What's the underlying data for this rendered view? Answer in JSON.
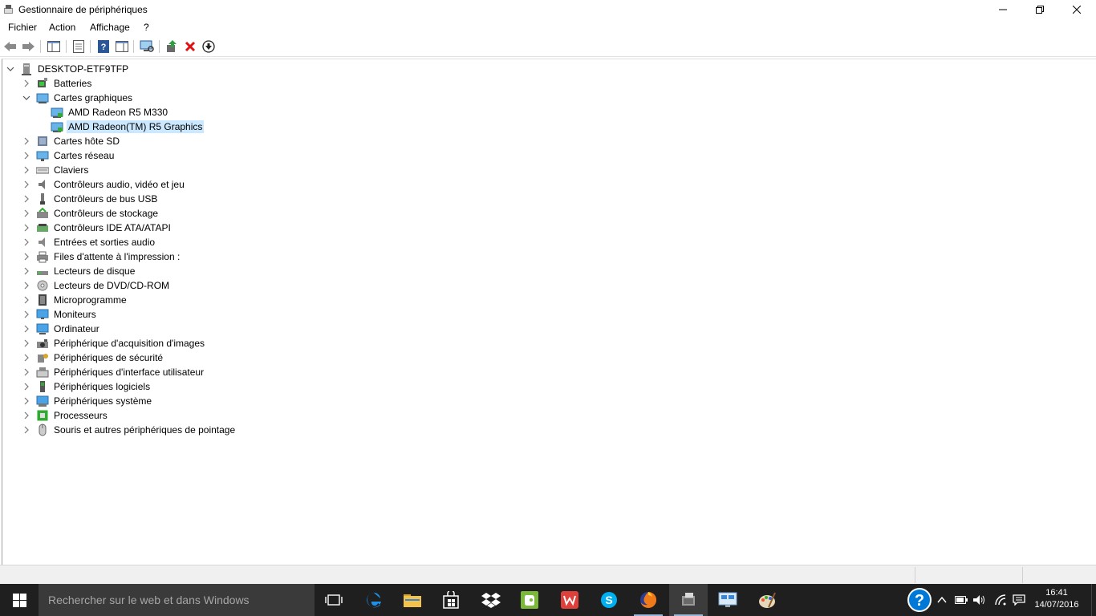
{
  "window": {
    "title": "Gestionnaire de périphériques"
  },
  "menu": [
    "Fichier",
    "Action",
    "Affichage",
    "?"
  ],
  "tree": {
    "root": "DESKTOP-ETF9TFP",
    "categories": [
      {
        "label": "Batteries",
        "icon": "battery-icon",
        "expanded": false
      },
      {
        "label": "Cartes graphiques",
        "icon": "display-adapter-icon",
        "expanded": true,
        "children": [
          "AMD Radeon R5 M330",
          "AMD Radeon(TM) R5 Graphics"
        ]
      },
      {
        "label": "Cartes hôte SD",
        "icon": "sd-host-icon",
        "expanded": false
      },
      {
        "label": "Cartes réseau",
        "icon": "network-adapter-icon",
        "expanded": false
      },
      {
        "label": "Claviers",
        "icon": "keyboard-icon",
        "expanded": false
      },
      {
        "label": "Contrôleurs audio, vidéo et jeu",
        "icon": "audio-icon",
        "expanded": false
      },
      {
        "label": "Contrôleurs de bus USB",
        "icon": "usb-icon",
        "expanded": false
      },
      {
        "label": "Contrôleurs de stockage",
        "icon": "storage-controller-icon",
        "expanded": false
      },
      {
        "label": "Contrôleurs IDE ATA/ATAPI",
        "icon": "ide-icon",
        "expanded": false
      },
      {
        "label": "Entrées et sorties audio",
        "icon": "audio-io-icon",
        "expanded": false
      },
      {
        "label": "Files d'attente à l'impression :",
        "icon": "printer-icon",
        "expanded": false
      },
      {
        "label": "Lecteurs de disque",
        "icon": "disk-drive-icon",
        "expanded": false
      },
      {
        "label": "Lecteurs de DVD/CD-ROM",
        "icon": "dvd-icon",
        "expanded": false
      },
      {
        "label": "Microprogramme",
        "icon": "firmware-icon",
        "expanded": false
      },
      {
        "label": "Moniteurs",
        "icon": "monitor-icon",
        "expanded": false
      },
      {
        "label": "Ordinateur",
        "icon": "computer-icon",
        "expanded": false
      },
      {
        "label": "Périphérique d'acquisition d'images",
        "icon": "imaging-icon",
        "expanded": false
      },
      {
        "label": "Périphériques de sécurité",
        "icon": "security-icon",
        "expanded": false
      },
      {
        "label": "Périphériques d'interface utilisateur",
        "icon": "hid-icon",
        "expanded": false
      },
      {
        "label": "Périphériques logiciels",
        "icon": "software-device-icon",
        "expanded": false
      },
      {
        "label": "Périphériques système",
        "icon": "system-device-icon",
        "expanded": false
      },
      {
        "label": "Processeurs",
        "icon": "processor-icon",
        "expanded": false
      },
      {
        "label": "Souris et autres périphériques de pointage",
        "icon": "mouse-icon",
        "expanded": false
      }
    ],
    "selected": "AMD Radeon(TM) R5 Graphics"
  },
  "taskbar": {
    "search_placeholder": "Rechercher sur le web et dans Windows",
    "apps": [
      "task-view-icon",
      "edge-icon",
      "file-explorer-icon",
      "store-icon",
      "dropbox-icon",
      "evernote-icon",
      "wps-icon",
      "skype-icon",
      "firefox-icon",
      "device-manager-icon",
      "remote-desktop-icon",
      "paint-icon"
    ],
    "clock_time": "16:41",
    "clock_date": "14/07/2016"
  },
  "colors": {
    "selection": "#cce8ff",
    "taskbar": "#1f1f1f",
    "accent": "#0078d7"
  }
}
